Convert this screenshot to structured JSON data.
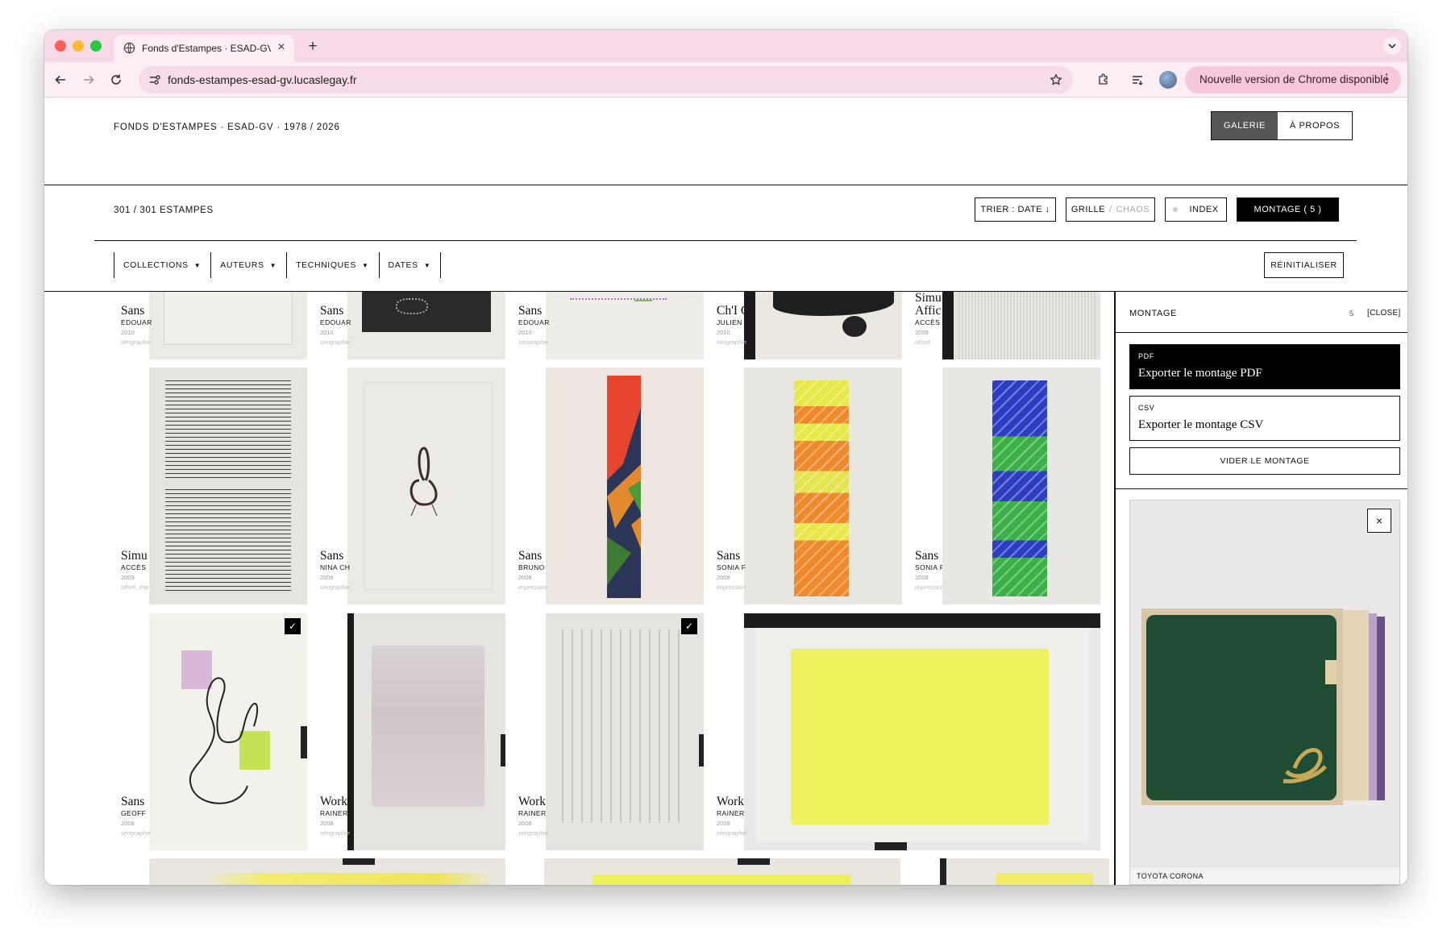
{
  "browser": {
    "tab_title": "Fonds d'Estampes · ESAD-GV",
    "url": "fonds-estampes-esad-gv.lucaslegay.fr",
    "update_label": "Nouvelle version de Chrome disponible"
  },
  "site": {
    "title": "FONDS D'ESTAMPES · ESAD-GV · 1978 / 2026",
    "nav": {
      "gallery": "GALERIE",
      "about": "À PROPOS"
    }
  },
  "controls": {
    "count": "301 / 301 ESTAMPES",
    "sort": "TRIER : DATE ↓",
    "grid": "GRILLE",
    "sep": "/",
    "chaos": "CHAOS",
    "index": "INDEX",
    "montage": "MONTAGE ( 5 )"
  },
  "filters": {
    "collections": "COLLECTIONS",
    "authors": "AUTEURS",
    "techniques": "TECHNIQUES",
    "dates": "DATES",
    "reset": "RÉINITIALISER"
  },
  "cards": [
    {
      "title": "Sans",
      "author": "EDOUAR",
      "year": "2010",
      "tech": "sérigraphie"
    },
    {
      "title": "Sans",
      "author": "EDOUAR",
      "year": "2010",
      "tech": "sérigraphie"
    },
    {
      "title": "Sans",
      "author": "EDOUAR",
      "year": "2010",
      "tech": "sérigraphie"
    },
    {
      "title": "Ch'I C",
      "author": "JULIEN",
      "year": "2010",
      "tech": "sérigraphie"
    },
    {
      "title": "Simu Affic",
      "author": "ACCÈS",
      "year": "2009",
      "tech": "offset"
    },
    {
      "title": "Simu",
      "author": "ACCÈS",
      "year": "2009",
      "tech": "offset, imp"
    },
    {
      "title": "Sans",
      "author": "NINA CH",
      "year": "2009",
      "tech": "sérigraphie"
    },
    {
      "title": "Sans",
      "author": "BRUNO",
      "year": "2008",
      "tech": "impression"
    },
    {
      "title": "Sans",
      "author": "SONIA F",
      "year": "2008",
      "tech": "impression"
    },
    {
      "title": "Sans",
      "author": "SONIA F",
      "year": "2008",
      "tech": "impression"
    },
    {
      "title": "Sans",
      "author": "GEOFF",
      "year": "2008",
      "tech": "sérigraphie"
    },
    {
      "title": "Work",
      "author": "RAINER",
      "year": "2008",
      "tech": "sérigraphie"
    },
    {
      "title": "Work",
      "author": "RAINER",
      "year": "2008",
      "tech": "sérigraphie"
    },
    {
      "title": "Work",
      "author": "RAINER",
      "year": "2008",
      "tech": "sérigraphie"
    }
  ],
  "check_mark": "✓",
  "panel": {
    "title": "MONTAGE",
    "count": "5",
    "close": "[CLOSE]",
    "pdf_small": "PDF",
    "pdf_big": "Exporter le montage PDF",
    "csv_small": "CSV",
    "csv_big": "Exporter le montage CSV",
    "clear": "VIDER LE MONTAGE",
    "preview_close": "×",
    "preview_caption": "TOYOTA CORONA"
  },
  "colors": {
    "tabstrip": "#f6d9e6",
    "toolbar": "#fbeef4",
    "accent_dark": "#000000",
    "nav_active": "#555555"
  }
}
